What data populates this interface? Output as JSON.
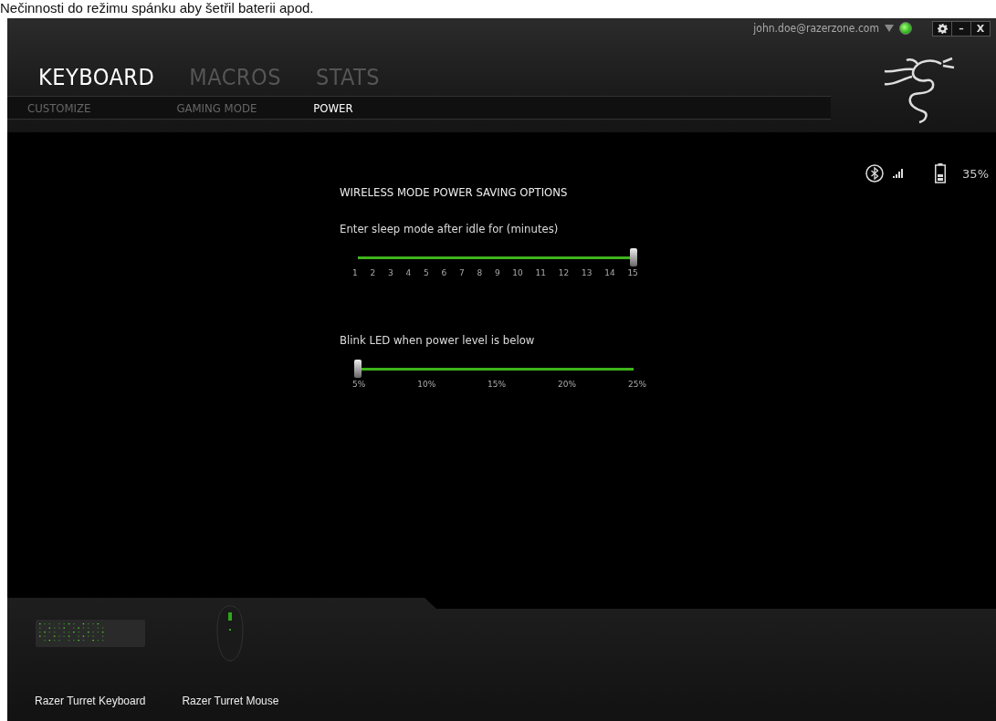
{
  "caption": "Nečinnosti do režimu spánku aby šetřil baterii apod.",
  "account": {
    "email": "john.doe@razerzone.com",
    "online": true
  },
  "window_controls": {
    "minimize": "–",
    "close": "X"
  },
  "tabs": [
    {
      "label": "KEYBOARD",
      "selected": true
    },
    {
      "label": "MACROS",
      "selected": false
    },
    {
      "label": "STATS",
      "selected": false
    }
  ],
  "subtabs": [
    {
      "label": "CUSTOMIZE",
      "selected": false
    },
    {
      "label": "GAMING MODE",
      "selected": false
    },
    {
      "label": "POWER",
      "selected": true
    }
  ],
  "status": {
    "battery_reading": "35%"
  },
  "section_title": "WIRELESS MODE POWER SAVING OPTIONS",
  "sliders": [
    {
      "label": "Enter sleep mode after idle for (minutes)",
      "level": 1,
      "ticks": [
        "1",
        "2",
        "3",
        "4",
        "5",
        "6",
        "7",
        "8",
        "9",
        "10",
        "11",
        "12",
        "13",
        "14",
        "15"
      ]
    },
    {
      "label": "Blink LED when power level is below",
      "level": 0,
      "ticks": [
        "5%",
        "10%",
        "15%",
        "20%",
        "25%"
      ]
    }
  ],
  "devices": [
    {
      "name": "Razer Turret Keyboard",
      "kind": "keyboard"
    },
    {
      "name": "Razer Turret Mouse",
      "kind": "mouse"
    }
  ]
}
